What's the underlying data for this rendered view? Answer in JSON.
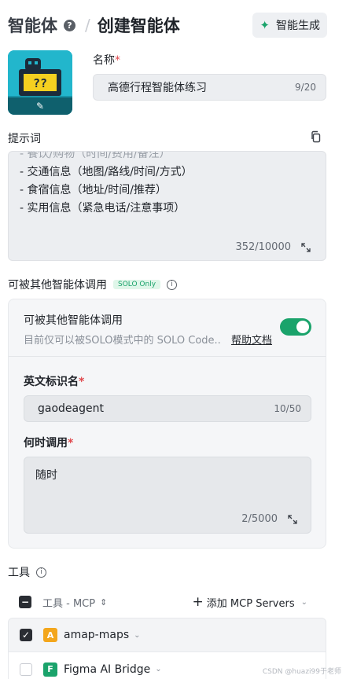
{
  "header": {
    "breadcrumb_root": "智能体",
    "help_glyph": "?",
    "separator": "/",
    "page_title": "创建智能体",
    "generate_button": "智能生成"
  },
  "avatar": {
    "screen_text": "??"
  },
  "name": {
    "label": "名称",
    "required_mark": "*",
    "value": "高德行程智能体练习",
    "counter": "9/20"
  },
  "prompt": {
    "label": "提示词",
    "lines": [
      "- 餐饮/购物（时间/费用/备注）",
      "- 交通信息（地图/路线/时间/方式）",
      "- 食宿信息（地址/时间/推荐）",
      "- 实用信息（紧急电话/注意事项）"
    ],
    "counter": "352/10000"
  },
  "callable": {
    "section_label": "可被其他智能体调用",
    "badge": "SOLO Only",
    "info_glyph": "i",
    "card_title": "可被其他智能体调用",
    "card_desc": "目前仅可以被SOLO模式中的 SOLO Code...",
    "help_link": "帮助文档",
    "enabled": true,
    "english_id": {
      "label": "英文标识名",
      "required_mark": "*",
      "value": "gaodeagent",
      "counter": "10/50"
    },
    "when_to_call": {
      "label": "何时调用",
      "required_mark": "*",
      "value": "随时",
      "counter": "2/5000"
    }
  },
  "tools": {
    "label": "工具",
    "info_glyph": "i",
    "column_title": "工具 - MCP",
    "sort_glyph": "⇕",
    "add_button": "添加 MCP Servers",
    "items": [
      {
        "letter": "A",
        "name": "amap-maps",
        "checked": true,
        "color": "#f3a61c"
      },
      {
        "letter": "F",
        "name": "Figma AI Bridge",
        "checked": false,
        "color": "#1aa36b"
      }
    ]
  },
  "watermark": "CSDN @huazi99于老师",
  "colors": {
    "accent": "#1aa36b",
    "required": "#e0484d"
  }
}
